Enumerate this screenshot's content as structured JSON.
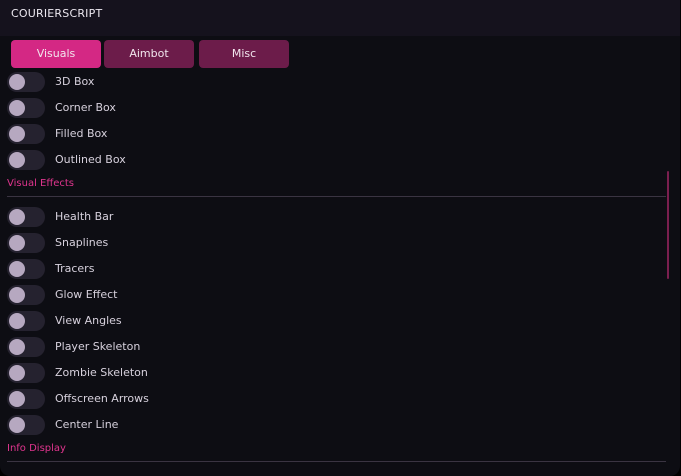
{
  "app": {
    "title": "COURIERSCRIPT"
  },
  "tabs": [
    {
      "label": "Visuals",
      "active": true
    },
    {
      "label": "Aimbot",
      "active": false
    },
    {
      "label": "Misc",
      "active": false
    }
  ],
  "colors": {
    "accent": "#d42884",
    "tab_inactive": "#6c1c4a",
    "section_text": "#e0358e",
    "background": "#0d0d13"
  },
  "boxes": {
    "items": [
      {
        "label": "3D Box",
        "on": false
      },
      {
        "label": "Corner Box",
        "on": false
      },
      {
        "label": "Filled Box",
        "on": false
      },
      {
        "label": "Outlined Box",
        "on": false
      }
    ]
  },
  "visual_effects": {
    "title": "Visual Effects",
    "items": [
      {
        "label": "Health Bar",
        "on": false
      },
      {
        "label": "Snaplines",
        "on": false
      },
      {
        "label": "Tracers",
        "on": false
      },
      {
        "label": "Glow Effect",
        "on": false
      },
      {
        "label": "View Angles",
        "on": false
      },
      {
        "label": "Player Skeleton",
        "on": false
      },
      {
        "label": "Zombie Skeleton",
        "on": false
      },
      {
        "label": "Offscreen Arrows",
        "on": false
      },
      {
        "label": "Center Line",
        "on": false
      }
    ]
  },
  "info_display": {
    "title": "Info Display"
  }
}
